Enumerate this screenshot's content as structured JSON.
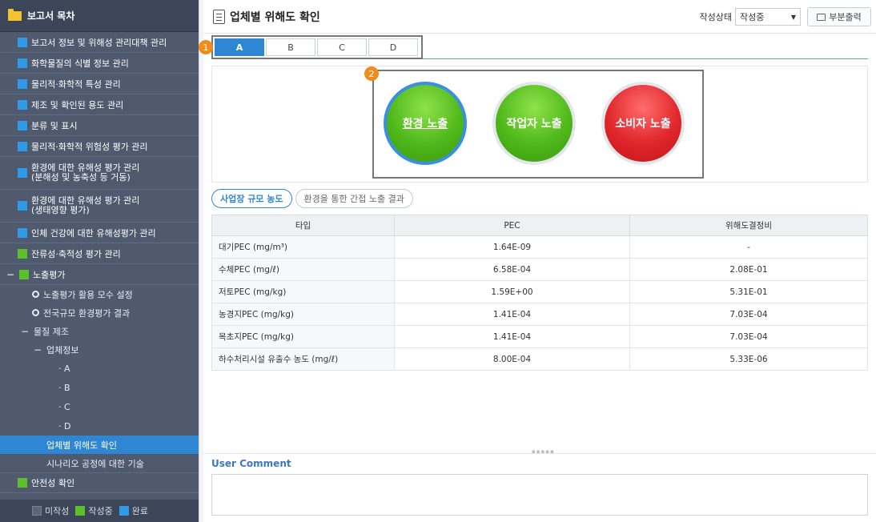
{
  "sidebar": {
    "title": "보고서 목차",
    "items": [
      {
        "label": "보고서 정보 및 위해성 관리대책 관리",
        "status": "blue"
      },
      {
        "label": "화학물질의 식별 정보 관리",
        "status": "blue"
      },
      {
        "label": "물리적·화학적 특성 관리",
        "status": "blue"
      },
      {
        "label": "제조 및 확인된 용도 관리",
        "status": "blue"
      },
      {
        "label": "분류 및 표시",
        "status": "blue"
      },
      {
        "label": "물리적·화학적 위험성 평가 관리",
        "status": "blue"
      },
      {
        "label": "환경에 대한 유해성 평가 관리\n(분해성 및 농축성 등 거동)",
        "status": "blue"
      },
      {
        "label": "환경에 대한 유해성 평가 관리\n(생태영향 평가)",
        "status": "blue"
      },
      {
        "label": "인체 건강에 대한 유해성평가 관리",
        "status": "blue"
      },
      {
        "label": "잔류성·축적성 평가 관리",
        "status": "green"
      }
    ],
    "exposure": {
      "label": "노출평가",
      "children": {
        "model_setting": "노출평가 활용 모수 설정",
        "national_result": "전국규모 환경평가 결과",
        "substance_mfg": "물질 제조",
        "company_info": "업체정보",
        "companies": [
          "A",
          "B",
          "C",
          "D"
        ],
        "risk_check": "업체별 위해도 확인",
        "scenario": "시나리오 공정에 대한 기술"
      }
    },
    "safety": "안전성 확인",
    "legend": {
      "not_written": "미작성",
      "writing": "작성중",
      "done": "완료"
    }
  },
  "header": {
    "title": "업체별 위해도 확인",
    "status_label": "작성상태",
    "status_value": "작성중",
    "print_label": "부분출력"
  },
  "tabs": [
    "A",
    "B",
    "C",
    "D"
  ],
  "badges": {
    "one": "1",
    "two": "2"
  },
  "exposure_buttons": {
    "env": "환경 노출",
    "worker": "작업자 노출",
    "consumer": "소비자 노출"
  },
  "subtabs": {
    "site": "사업장 규모 농도",
    "indirect": "환경을 통한 간접 노출 결과"
  },
  "table": {
    "headers": [
      "타입",
      "PEC",
      "위해도결정비"
    ],
    "rows": [
      [
        "대기PEC (mg/m³)",
        "1.64E-09",
        "-"
      ],
      [
        "수체PEC (mg/ℓ)",
        "6.58E-04",
        "2.08E-01"
      ],
      [
        "저토PEC (mg/kg)",
        "1.59E+00",
        "5.31E-01"
      ],
      [
        "농경지PEC (mg/kg)",
        "1.41E-04",
        "7.03E-04"
      ],
      [
        "목초지PEC (mg/kg)",
        "1.41E-04",
        "7.03E-04"
      ],
      [
        "하수처리시설 유출수 농도 (mg/ℓ)",
        "8.00E-04",
        "5.33E-06"
      ]
    ]
  },
  "comment": {
    "label": "User Comment",
    "value": ""
  },
  "colors": {
    "accent": "#2f86d2",
    "green": "#4fb81a",
    "red": "#e0262b",
    "badge": "#f08b1d"
  }
}
